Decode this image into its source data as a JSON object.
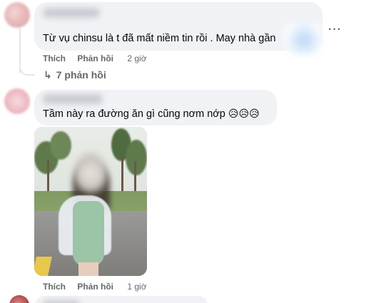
{
  "comment1": {
    "text": "Từ vụ chinsu là t đã mất niềm tin rồi . May nhà gần",
    "actions": {
      "like": "Thích",
      "reply": "Phản hồi",
      "time": "2 giờ"
    },
    "replies_link": "7 phản hồi",
    "more_label": "···"
  },
  "comment2": {
    "text": "Tầm này ra đường ăn gì cũng nơm nớp",
    "emojis": "😥😥😥",
    "actions": {
      "like": "Thích",
      "reply": "Phản hồi",
      "time": "1 giờ"
    }
  },
  "icons": {
    "more": "more-options-icon",
    "reply_arrow": "reply-arrow-icon"
  },
  "colors": {
    "bubble": "#f0f2f5",
    "meta_text": "#65676b"
  }
}
